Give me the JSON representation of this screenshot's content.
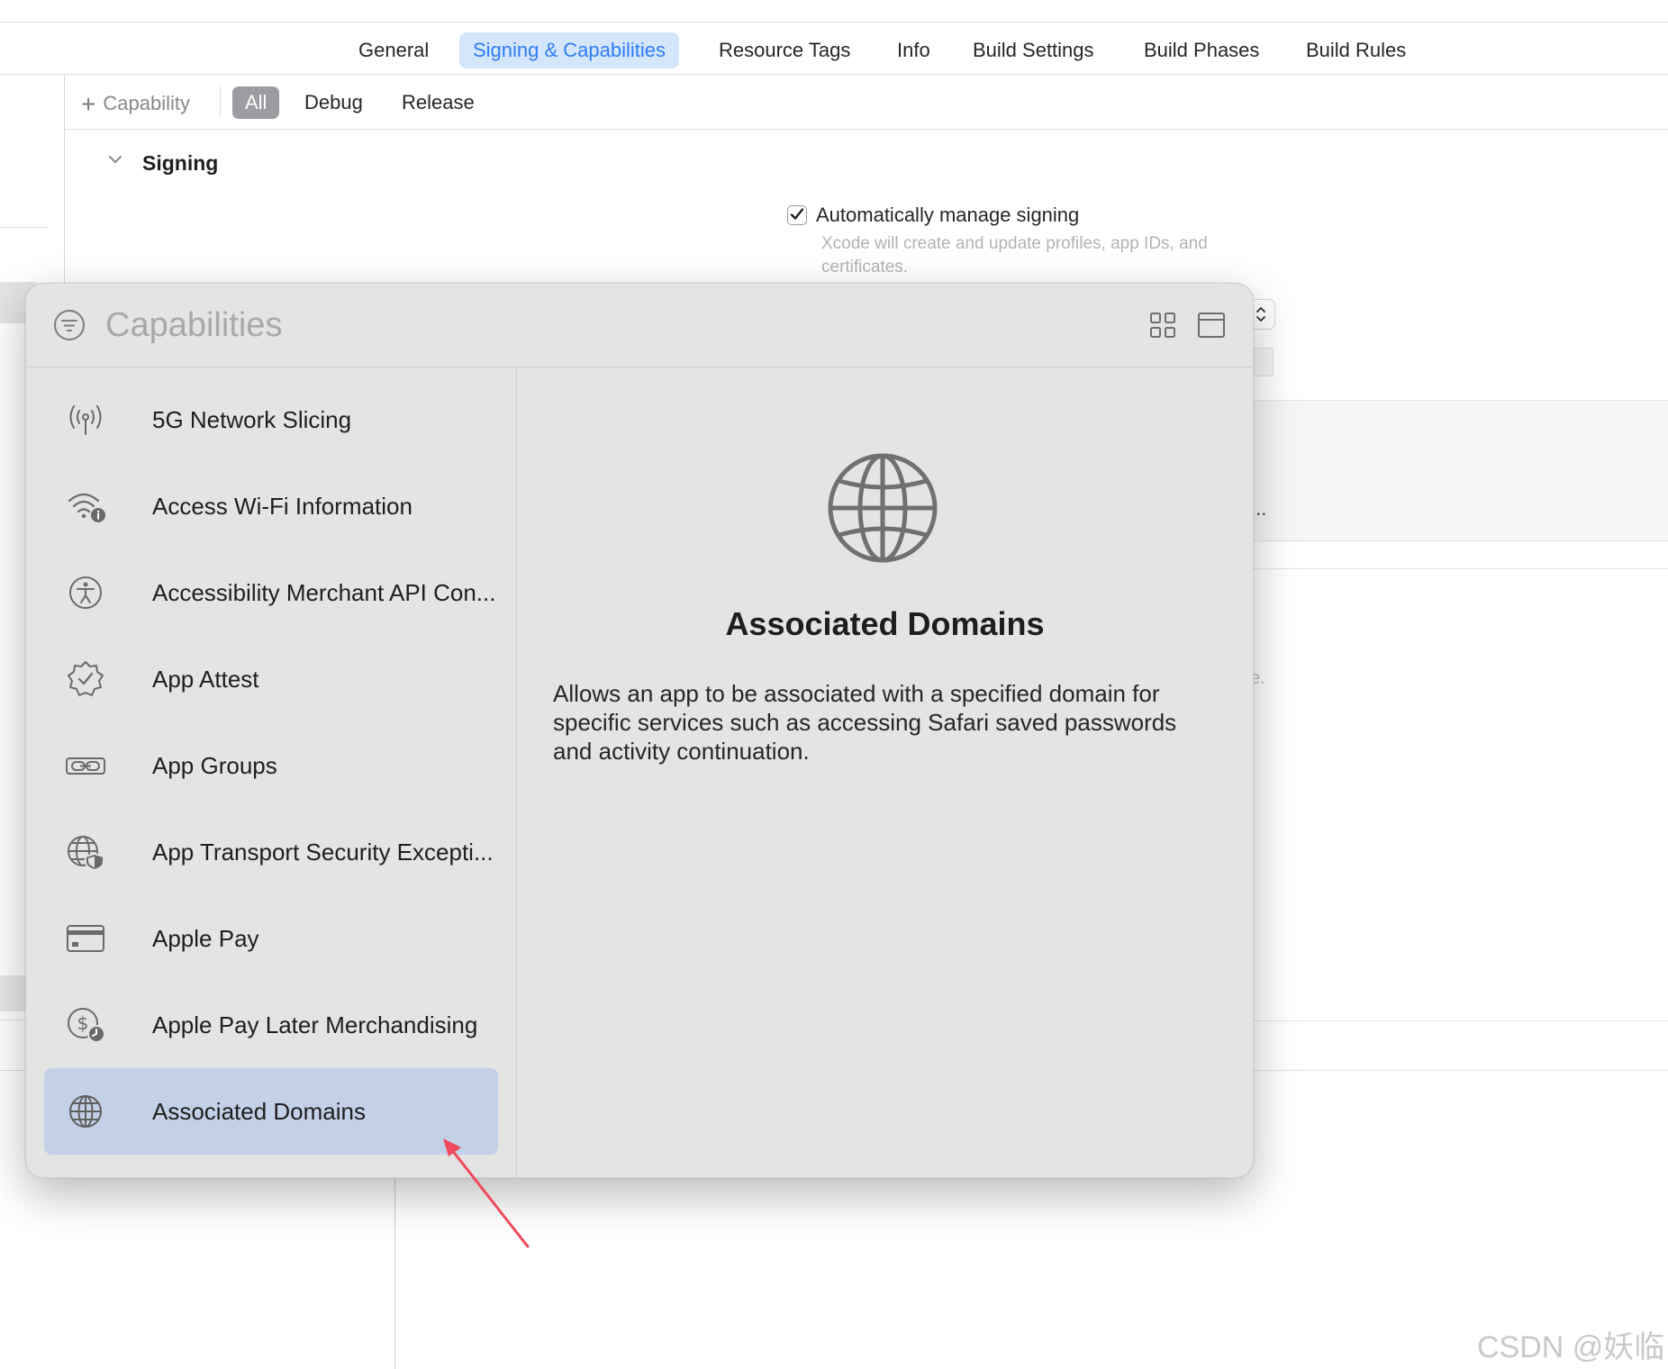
{
  "tabs": {
    "general": "General",
    "signing": "Signing & Capabilities",
    "resource_tags": "Resource Tags",
    "info": "Info",
    "build_settings": "Build Settings",
    "build_phases": "Build Phases",
    "build_rules": "Build Rules",
    "active": "Signing & Capabilities"
  },
  "filterbar": {
    "add_capability": "Capability",
    "all": "All",
    "debug": "Debug",
    "release": "Release",
    "active": "All"
  },
  "signing": {
    "section_title": "Signing",
    "auto_manage_label": "Automatically manage signing",
    "auto_manage_checked": true,
    "auto_manage_help": "Xcode will create and update profiles, app IDs, and certificates."
  },
  "background": {
    "ellipsis": "...",
    "fragment": "e."
  },
  "popover": {
    "search_placeholder": "Capabilities",
    "items": [
      {
        "label": "5G Network Slicing",
        "icon": "antenna-icon"
      },
      {
        "label": "Access Wi-Fi Information",
        "icon": "wifi-info-icon"
      },
      {
        "label": "Accessibility Merchant API Con...",
        "icon": "accessibility-icon"
      },
      {
        "label": "App Attest",
        "icon": "checkmark-seal-icon"
      },
      {
        "label": "App Groups",
        "icon": "link-icon"
      },
      {
        "label": "App Transport Security Excepti...",
        "icon": "globe-shield-icon"
      },
      {
        "label": "Apple Pay",
        "icon": "credit-card-icon"
      },
      {
        "label": "Apple Pay Later Merchandising",
        "icon": "dollar-clock-icon"
      },
      {
        "label": "Associated Domains",
        "icon": "globe-icon"
      }
    ],
    "selected": "Associated Domains",
    "detail": {
      "title": "Associated Domains",
      "description": "Allows an app to be associated with a specified domain for specific services such as accessing Safari saved passwords and activity continuation.",
      "icon": "globe-icon"
    }
  },
  "annotation": {
    "color": "#f04a5a"
  },
  "colors": {
    "accent": "#2f7cf6",
    "selection": "#c3d1e8",
    "popover_bg": "#e4e4e4"
  },
  "watermark": "CSDN @妖临"
}
